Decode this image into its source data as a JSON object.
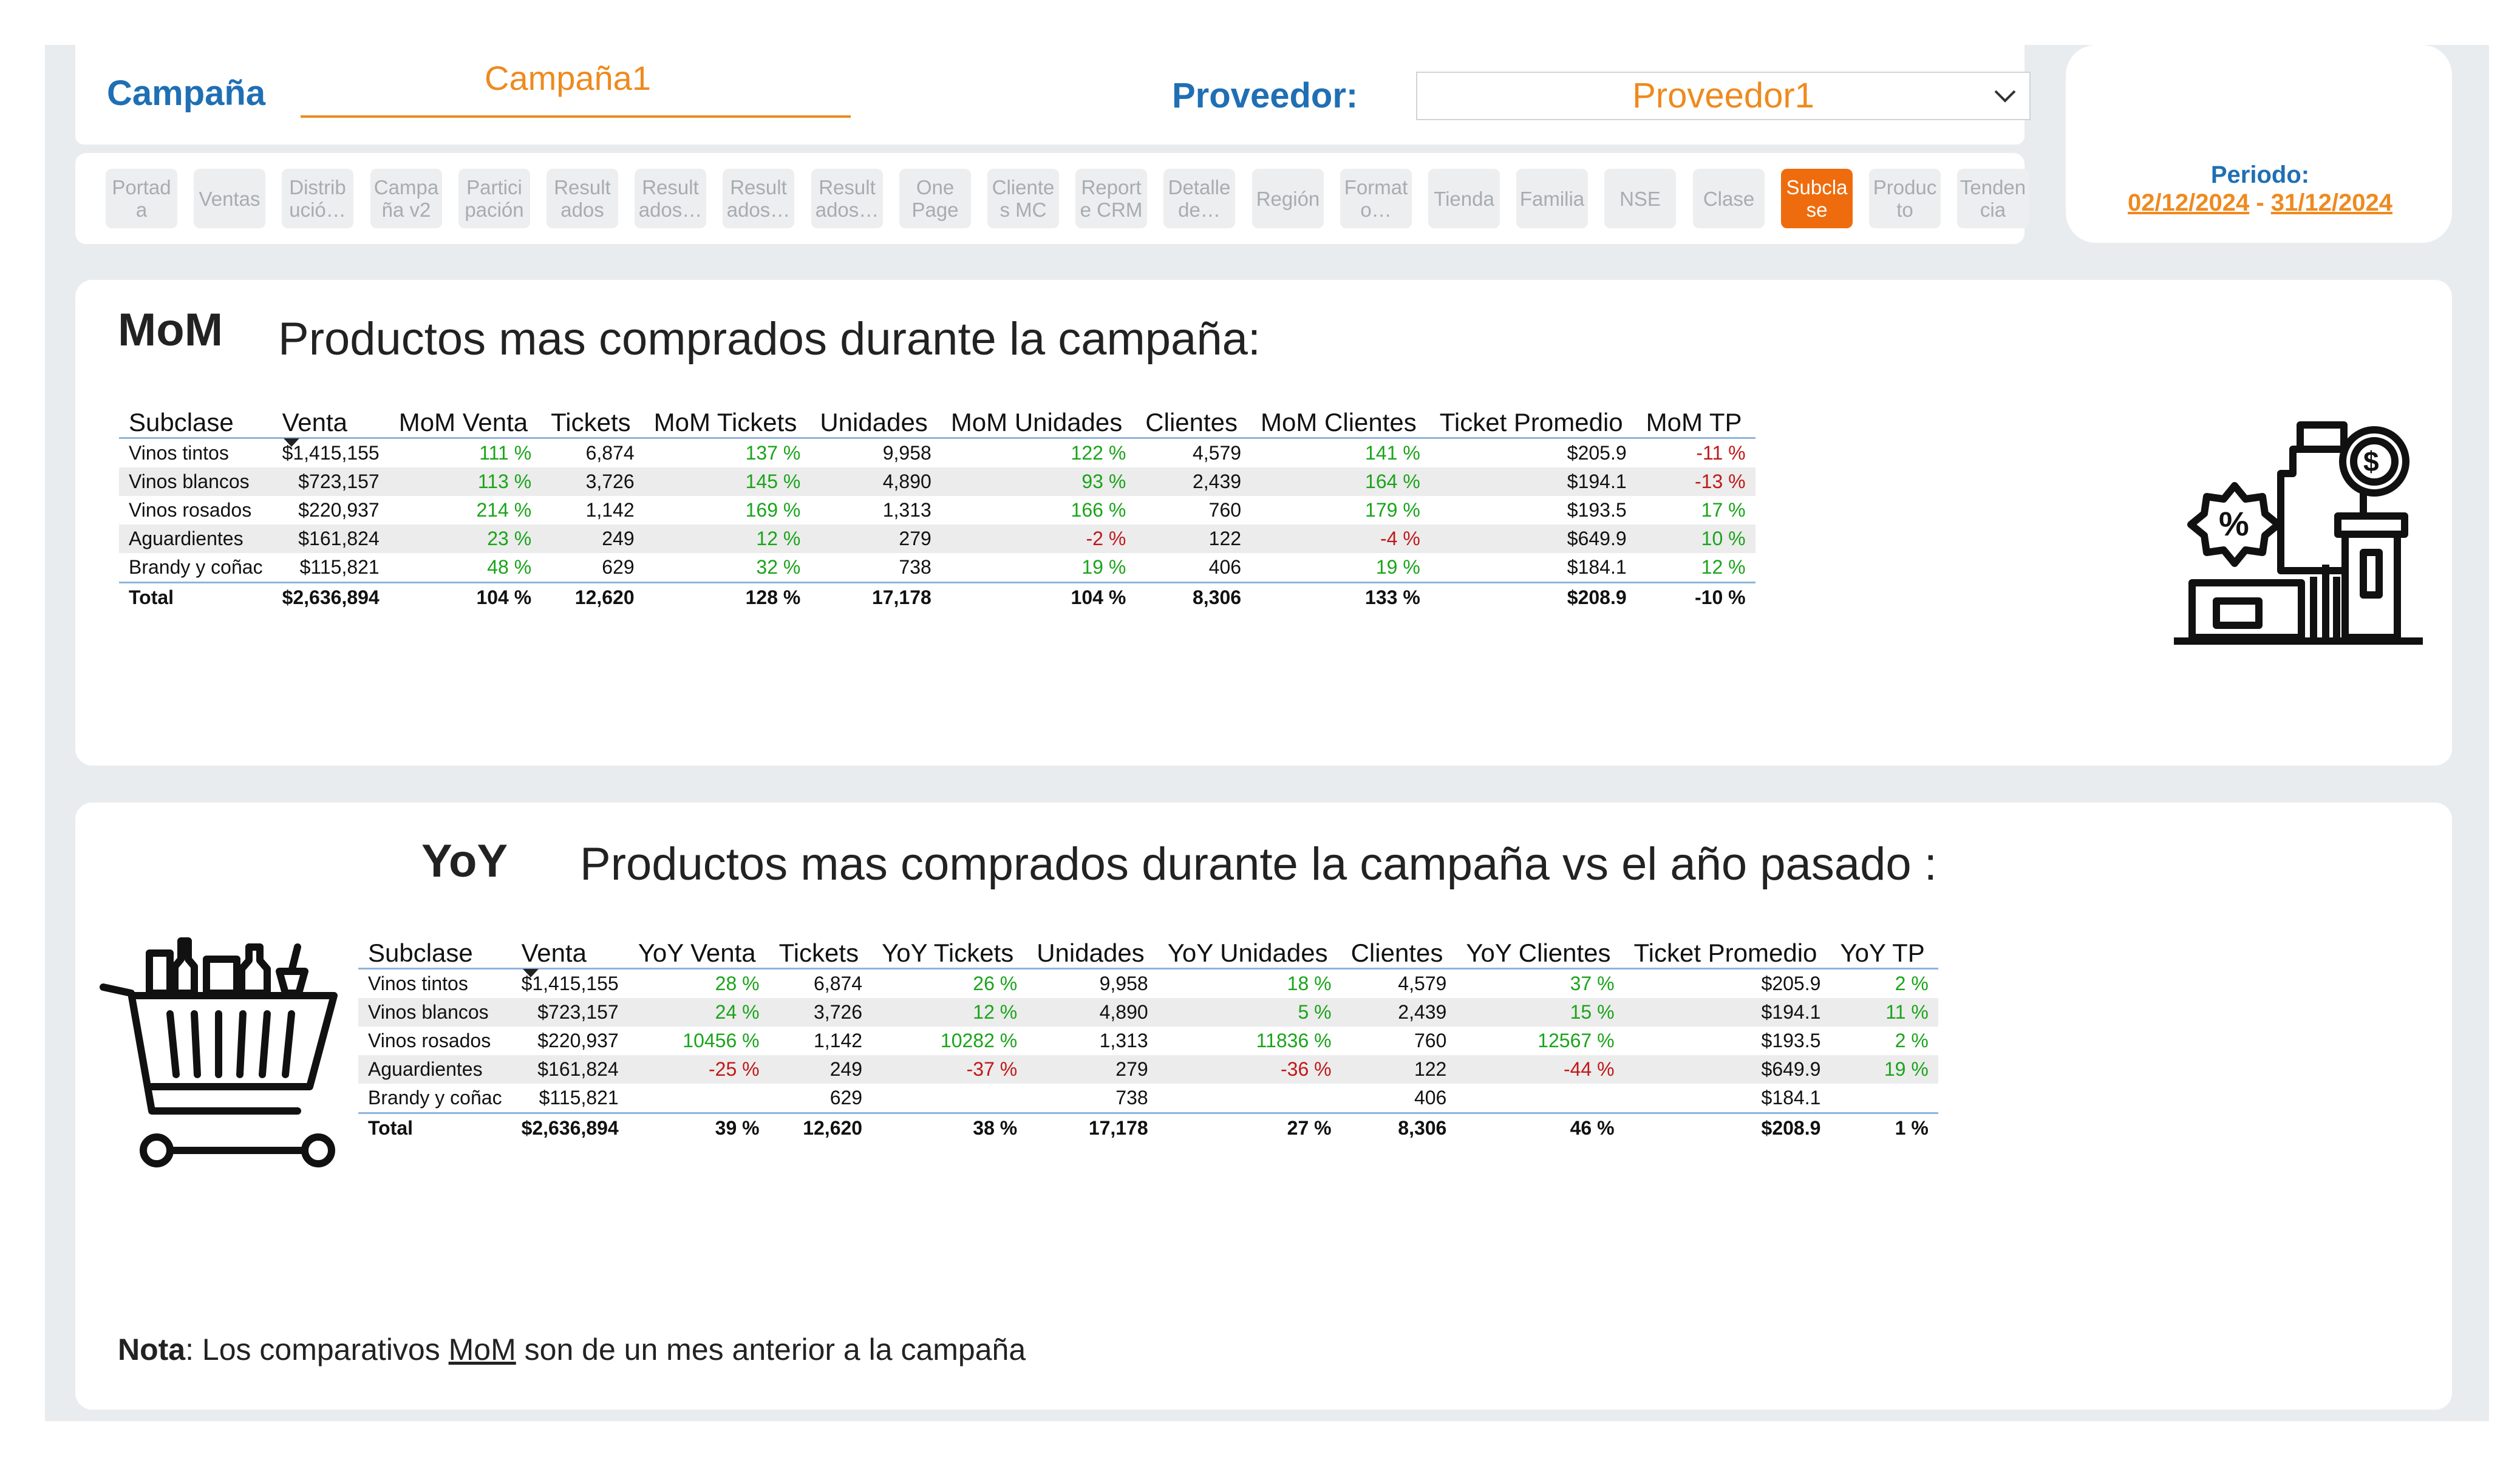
{
  "header": {
    "campana_label": "Campaña",
    "campana_value": "Campaña1",
    "proveedor_label": "Proveedor:",
    "proveedor_value": "Proveedor1",
    "periodo_label": "Periodo:",
    "periodo_start": "02/12/2024",
    "periodo_sep": "-",
    "periodo_end": "31/12/2024"
  },
  "nav": [
    {
      "label": "Portad a"
    },
    {
      "label": "Ventas"
    },
    {
      "label": "Distrib ució…"
    },
    {
      "label": "Campa ña v2"
    },
    {
      "label": "Partici pación"
    },
    {
      "label": "Result ados"
    },
    {
      "label": "Result ados…"
    },
    {
      "label": "Result ados…"
    },
    {
      "label": "Result ados…"
    },
    {
      "label": "One Page"
    },
    {
      "label": "Cliente s MC"
    },
    {
      "label": "Report e CRM"
    },
    {
      "label": "Detalle de…"
    },
    {
      "label": "Región"
    },
    {
      "label": "Format o…"
    },
    {
      "label": "Tienda"
    },
    {
      "label": "Familia"
    },
    {
      "label": "NSE"
    },
    {
      "label": "Clase"
    },
    {
      "label": "Subcla se",
      "active": true
    },
    {
      "label": "Produc to"
    },
    {
      "label": "Tenden cia"
    }
  ],
  "mom": {
    "tag": "MoM",
    "title": "Productos mas comprados durante la campaña:",
    "columns": [
      "Subclase",
      "Venta",
      "MoM Venta",
      "Tickets",
      "MoM Tickets",
      "Unidades",
      "MoM Unidades",
      "Clientes",
      "MoM Clientes",
      "Ticket Promedio",
      "MoM TP"
    ],
    "rows": [
      [
        "Vinos tintos",
        "$1,415,155",
        "111 %",
        "6,874",
        "137 %",
        "9,958",
        "122 %",
        "4,579",
        "141 %",
        "$205.9",
        "-11 %"
      ],
      [
        "Vinos blancos",
        "$723,157",
        "113 %",
        "3,726",
        "145 %",
        "4,890",
        "93 %",
        "2,439",
        "164 %",
        "$194.1",
        "-13 %"
      ],
      [
        "Vinos rosados",
        "$220,937",
        "214 %",
        "1,142",
        "169 %",
        "1,313",
        "166 %",
        "760",
        "179 %",
        "$193.5",
        "17 %"
      ],
      [
        "Aguardientes",
        "$161,824",
        "23 %",
        "249",
        "12 %",
        "279",
        "-2 %",
        "122",
        "-4 %",
        "$649.9",
        "10 %"
      ],
      [
        "Brandy y coñac",
        "$115,821",
        "48 %",
        "629",
        "32 %",
        "738",
        "19 %",
        "406",
        "19 %",
        "$184.1",
        "12 %"
      ]
    ],
    "total": [
      "Total",
      "$2,636,894",
      "104 %",
      "12,620",
      "128 %",
      "17,178",
      "104 %",
      "8,306",
      "133 %",
      "$208.9",
      "-10 %"
    ]
  },
  "yoy": {
    "tag": "YoY",
    "title": "Productos mas comprados durante la campaña vs el año pasado :",
    "columns": [
      "Subclase",
      "Venta",
      "YoY Venta",
      "Tickets",
      "YoY Tickets",
      "Unidades",
      "YoY Unidades",
      "Clientes",
      "YoY Clientes",
      "Ticket Promedio",
      "YoY TP"
    ],
    "rows": [
      [
        "Vinos tintos",
        "$1,415,155",
        "28 %",
        "6,874",
        "26 %",
        "9,958",
        "18 %",
        "4,579",
        "37 %",
        "$205.9",
        "2 %"
      ],
      [
        "Vinos blancos",
        "$723,157",
        "24 %",
        "3,726",
        "12 %",
        "4,890",
        "5 %",
        "2,439",
        "15 %",
        "$194.1",
        "11 %"
      ],
      [
        "Vinos rosados",
        "$220,937",
        "10456 %",
        "1,142",
        "10282 %",
        "1,313",
        "11836 %",
        "760",
        "12567 %",
        "$193.5",
        "2 %"
      ],
      [
        "Aguardientes",
        "$161,824",
        "-25 %",
        "249",
        "-37 %",
        "279",
        "-36 %",
        "122",
        "-44 %",
        "$649.9",
        "19 %"
      ],
      [
        "Brandy y coñac",
        "$115,821",
        "",
        "629",
        "",
        "738",
        "",
        "406",
        "",
        "$184.1",
        ""
      ]
    ],
    "total": [
      "Total",
      "$2,636,894",
      "39 %",
      "12,620",
      "38 %",
      "17,178",
      "27 %",
      "8,306",
      "46 %",
      "$208.9",
      "1 %"
    ]
  },
  "nota": {
    "bold": "Nota",
    "pre": ": Los comparativos ",
    "underlined": "MoM",
    "post": " son de un mes anterior a la campaña"
  },
  "colors": {
    "accent_blue": "#1f6fb4",
    "accent_orange": "#ee8a1e",
    "active_tab": "#ee6c0d",
    "positive": "#1aa41a",
    "negative": "#c01818"
  },
  "icons": [
    "chevron-down-icon",
    "products-discount-icon",
    "shopping-cart-icon",
    "sort-desc-icon"
  ]
}
